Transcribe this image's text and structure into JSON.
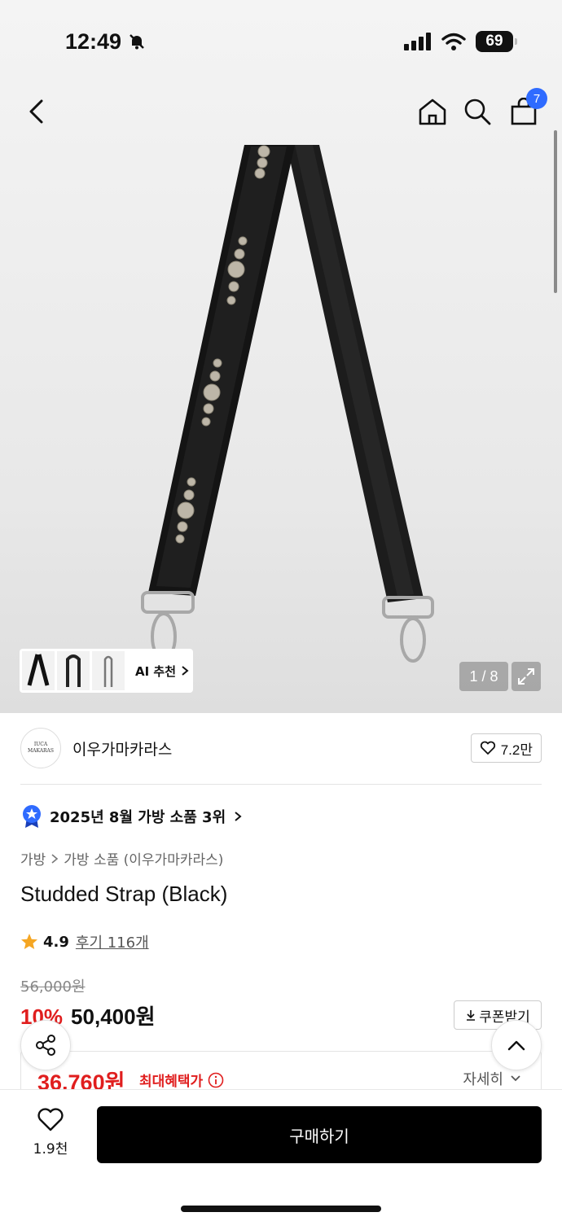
{
  "status_bar": {
    "time": "12:49",
    "battery": "69"
  },
  "header": {
    "cart_count": "7"
  },
  "gallery": {
    "ai_label": "AI 추천",
    "page_indicator": "1 / 8"
  },
  "brand": {
    "logo_line1": "IUCA",
    "logo_line2": "MAKARAS",
    "name": "이우가마카라스",
    "likes": "7.2만"
  },
  "ranking": {
    "text": "2025년 8월 가방 소품 3위"
  },
  "breadcrumb": {
    "level1": "가방",
    "level2": "가방 소품 (이우가마카라스)"
  },
  "product": {
    "title": "Studded Strap (Black)",
    "rating": "4.9",
    "reviews": "후기 116개",
    "original_price": "56,000원",
    "discount": "10%",
    "price": "50,400원",
    "coupon_label": "쿠폰받기",
    "benefit_price": "36,760원",
    "benefit_label": "최대혜택가",
    "detail_label": "자세히"
  },
  "bottom_bar": {
    "wish_count": "1.9천",
    "buy_label": "구매하기"
  },
  "colors": {
    "accent_red": "#e01e1e",
    "badge_blue": "#2f6bff",
    "rating_star": "#f5a623"
  }
}
